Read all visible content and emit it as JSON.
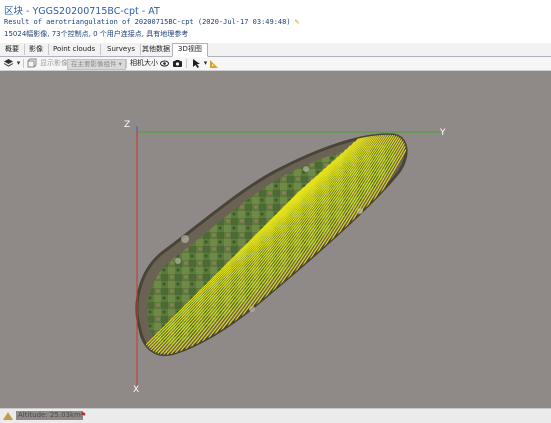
{
  "window": {
    "title": "区块 - YGGS20200715BC-cpt - AT",
    "subtitle": "Result of aerotriangulation of 20200715BC-cpt (2020-Jul-17 03:49:48)",
    "summary": "15024幅影像, 73个控制点, 0 个用户连接点, 具有地理参考",
    "edit_icon": "pencil-icon"
  },
  "tabs": [
    {
      "label": "概要"
    },
    {
      "label": "影像"
    },
    {
      "label": "Point clouds"
    },
    {
      "label": "Surveys"
    },
    {
      "label": "其他数据"
    },
    {
      "label": "3D视图",
      "active": true
    }
  ],
  "toolbar": {
    "layers_icon": "layers-icon",
    "cube_icon": "cube-icon",
    "show_images_label": "显示影像",
    "show_images_select": "在主要影像组件",
    "camera_size_label": "相机大小",
    "eye_icon": "eye-icon",
    "camera_icon": "camera-icon",
    "pointer_icon": "pointer-icon",
    "ruler_icon": "ruler-icon"
  },
  "viewport": {
    "axis_z": "Z",
    "axis_y": "Y",
    "axis_x": "X",
    "background": "#8f8a87",
    "flight_line_color": "#e8e51a"
  },
  "status": {
    "altitude": "Altitude: 25.03km"
  }
}
